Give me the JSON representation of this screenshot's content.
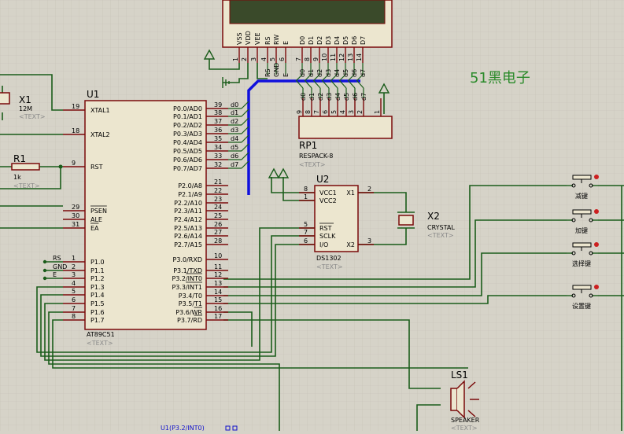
{
  "colors": {
    "background": "#d6d3c8",
    "wire": "#1a5c1a",
    "part_body": "#7a0a0a",
    "part_fill": "#ece6cf",
    "bus": "#1010dd",
    "brand": "#2a8a2a",
    "pin_label": "#1010cc"
  },
  "brand_text": "51黑电子",
  "placeholder": "<TEXT>",
  "u1": {
    "ref": "U1",
    "part": "AT89C51",
    "left_pins": [
      {
        "num": "19",
        "label": "XTAL1"
      },
      {
        "num": "18",
        "label": "XTAL2"
      },
      {
        "num": "9",
        "label": "RST"
      },
      {
        "num": "29",
        "label": "PSEN"
      },
      {
        "num": "30",
        "label": "ALE"
      },
      {
        "num": "31",
        "label": "EA"
      },
      {
        "num": "1",
        "label": "P1.0"
      },
      {
        "num": "2",
        "label": "P1.1"
      },
      {
        "num": "3",
        "label": "P1.2"
      },
      {
        "num": "4",
        "label": "P1.3"
      },
      {
        "num": "5",
        "label": "P1.4"
      },
      {
        "num": "6",
        "label": "P1.5"
      },
      {
        "num": "7",
        "label": "P1.6"
      },
      {
        "num": "8",
        "label": "P1.7"
      }
    ],
    "right_pins": [
      {
        "num": "39",
        "label": "P0.0/AD0"
      },
      {
        "num": "38",
        "label": "P0.1/AD1"
      },
      {
        "num": "37",
        "label": "P0.2/AD2"
      },
      {
        "num": "36",
        "label": "P0.3/AD3"
      },
      {
        "num": "35",
        "label": "P0.4/AD4"
      },
      {
        "num": "34",
        "label": "P0.5/AD5"
      },
      {
        "num": "33",
        "label": "P0.6/AD6"
      },
      {
        "num": "32",
        "label": "P0.7/AD7"
      },
      {
        "num": "21",
        "label": "P2.0/A8"
      },
      {
        "num": "22",
        "label": "P2.1/A9"
      },
      {
        "num": "23",
        "label": "P2.2/A10"
      },
      {
        "num": "24",
        "label": "P2.3/A11"
      },
      {
        "num": "25",
        "label": "P2.4/A12"
      },
      {
        "num": "26",
        "label": "P2.5/A13"
      },
      {
        "num": "27",
        "label": "P2.6/A14"
      },
      {
        "num": "28",
        "label": "P2.7/A15"
      },
      {
        "num": "10",
        "label": "P3.0/RXD"
      },
      {
        "num": "11",
        "label": "P3.1/TXD"
      },
      {
        "num": "12",
        "label": "P3.2/INT0"
      },
      {
        "num": "13",
        "label": "P3.3/INT1"
      },
      {
        "num": "14",
        "label": "P3.4/T0"
      },
      {
        "num": "15",
        "label": "P3.5/T1"
      },
      {
        "num": "16",
        "label": "P3.6/WR"
      },
      {
        "num": "17",
        "label": "P3.7/RD"
      }
    ],
    "net_labels_left": [
      "RS",
      "GND",
      "E"
    ],
    "net_labels_right": [
      "d0",
      "d1",
      "d2",
      "d3",
      "d4",
      "d5",
      "d6",
      "d7"
    ]
  },
  "x1": {
    "ref": "X1",
    "value": "12M"
  },
  "r1": {
    "ref": "R1",
    "value": "1k"
  },
  "lcd": {
    "pins": [
      "VSS",
      "VDD",
      "VEE",
      "RS",
      "RW",
      "E",
      "D0",
      "D1",
      "D2",
      "D3",
      "D4",
      "D5",
      "D6",
      "D7"
    ],
    "nums": [
      "1",
      "2",
      "3",
      "4",
      "5",
      "6",
      "7",
      "8",
      "9",
      "10",
      "11",
      "12",
      "13",
      "14"
    ],
    "net_labels": [
      "RS",
      "GND",
      "E",
      "d0",
      "d1",
      "d2",
      "d3",
      "d4",
      "d5",
      "d6",
      "d7"
    ]
  },
  "rp1": {
    "ref": "RP1",
    "part": "RESPACK-8",
    "nets": [
      "d0",
      "d1",
      "d2",
      "d3",
      "d4",
      "d5",
      "d6",
      "d7"
    ],
    "nums": [
      "9",
      "8",
      "7",
      "6",
      "5",
      "4",
      "3",
      "2",
      "1"
    ]
  },
  "u2": {
    "ref": "U2",
    "part": "DS1302",
    "left_pins": [
      {
        "num": "8",
        "label": "VCC1"
      },
      {
        "num": "1",
        "label": "VCC2"
      },
      {
        "num": "5",
        "label": "RST"
      },
      {
        "num": "7",
        "label": "SCLK"
      },
      {
        "num": "6",
        "label": "I/O"
      }
    ],
    "right_pins": [
      {
        "num": "2",
        "label": "X1"
      },
      {
        "num": "3",
        "label": "X2"
      }
    ]
  },
  "x2": {
    "ref": "X2",
    "part": "CRYSTAL"
  },
  "buttons": [
    "减键",
    "加键",
    "选择键",
    "设置键"
  ],
  "ls1": {
    "ref": "LS1",
    "part": "SPEAKER"
  },
  "probe_label": "U1(P3.2/INT0)"
}
